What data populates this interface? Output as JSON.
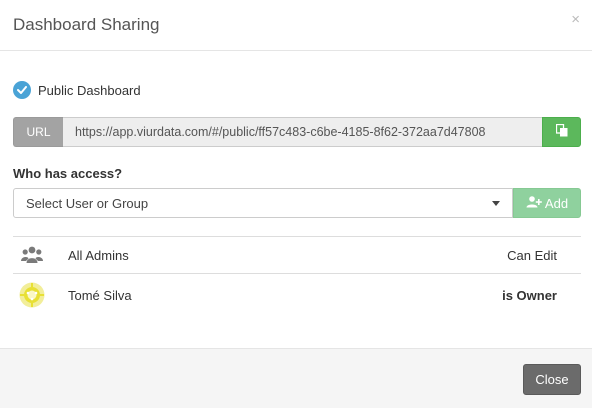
{
  "modal": {
    "title": "Dashboard Sharing",
    "close_symbol": "×"
  },
  "public_dashboard": {
    "label": "Public Dashboard",
    "checked": true,
    "icon": "check-circle-icon",
    "color": "#4aa3d6"
  },
  "url_field": {
    "addon_label": "URL",
    "value": "https://app.viurdata.com/#/public/ff57c483-c6be-4185-8f62-372aa7d47808",
    "copy_icon": "copy-icon",
    "copy_color": "#5cb85c"
  },
  "access": {
    "label": "Who has access?",
    "select_placeholder": "Select User or Group",
    "add_label": "Add",
    "add_icon": "user-plus-icon",
    "add_color": "#8fd19e"
  },
  "access_list": [
    {
      "icon": "users-group-icon",
      "name": "All Admins",
      "permission": "Can Edit"
    },
    {
      "icon": "user-avatar-icon",
      "name": "Tomé Silva",
      "permission": "is Owner"
    }
  ],
  "footer": {
    "close_label": "Close",
    "close_color": "#6b6b6b"
  }
}
